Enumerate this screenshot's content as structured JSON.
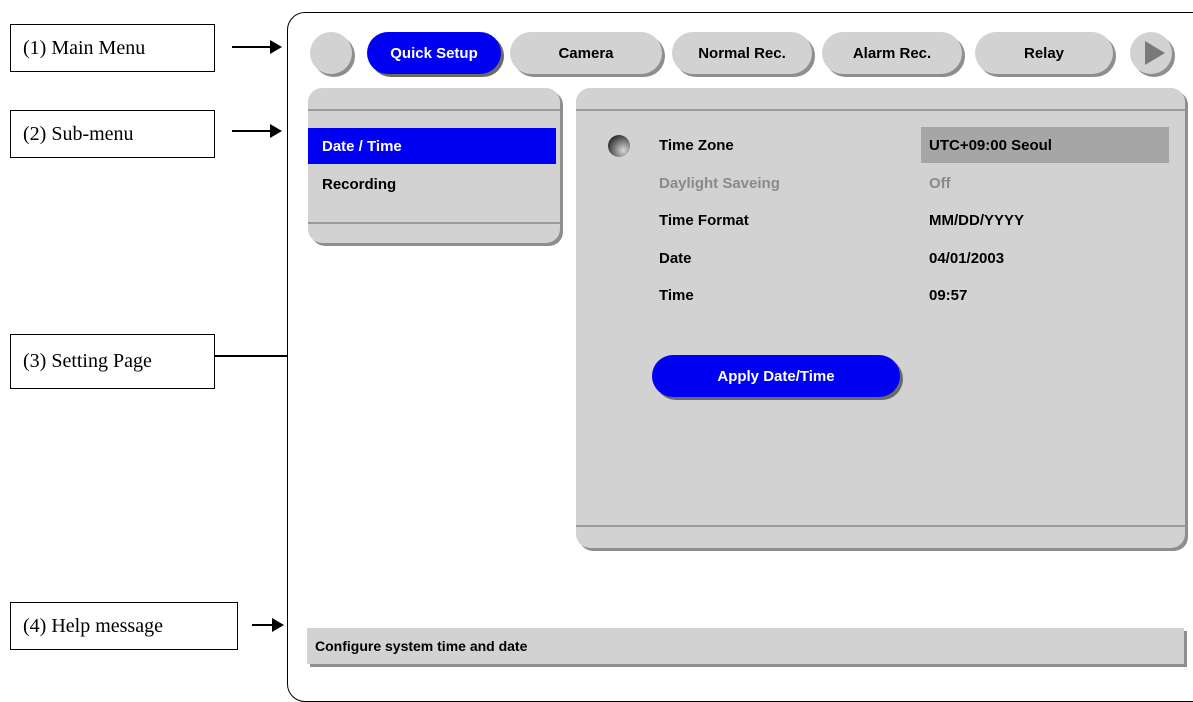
{
  "callouts": [
    {
      "label": "(1) Main Menu"
    },
    {
      "label": "(2) Sub-menu"
    },
    {
      "label": "(3) Setting Page"
    },
    {
      "label": "(4) Help message"
    }
  ],
  "main_menu": {
    "tabs": [
      {
        "label": "Quick Setup",
        "active": true
      },
      {
        "label": "Camera"
      },
      {
        "label": "Normal Rec."
      },
      {
        "label": "Alarm Rec."
      },
      {
        "label": "Relay"
      }
    ],
    "prev_icon": "blank-circle-icon",
    "next_icon": "play-right-icon"
  },
  "sub_menu": {
    "items": [
      {
        "label": "Date / Time",
        "active": true
      },
      {
        "label": "Recording"
      }
    ]
  },
  "settings": {
    "rows": [
      {
        "label": "Time Zone",
        "value": "UTC+09:00 Seoul",
        "selected": true
      },
      {
        "label": "Daylight Saveing",
        "value": "Off",
        "disabled": true
      },
      {
        "label": "Time Format",
        "value": "MM/DD/YYYY"
      },
      {
        "label": "Date",
        "value": "04/01/2003"
      },
      {
        "label": "Time",
        "value": "09:57"
      }
    ],
    "apply_button": "Apply Date/Time",
    "selector_icon": "radio-indicator-icon"
  },
  "help": {
    "message": "Configure system time and date"
  },
  "colors": {
    "accent": "#0000f2",
    "panel": "#d2d2d2",
    "selected_value_bg": "#a6a6a6",
    "disabled_text": "#8a8a8a"
  }
}
